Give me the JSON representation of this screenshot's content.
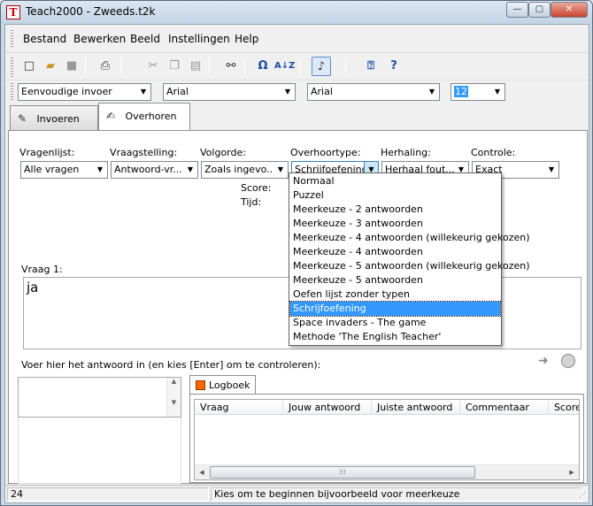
{
  "window": {
    "title": "Teach2000  -  Zweeds.t2k",
    "app_icon": "T"
  },
  "window_controls": {
    "minimize": "—",
    "maximize": "▢",
    "close": "✕"
  },
  "menu": [
    {
      "label": "Bestand"
    },
    {
      "label": "Bewerken"
    },
    {
      "label": "Beeld"
    },
    {
      "label": "Instellingen"
    },
    {
      "label": "Help"
    }
  ],
  "toolbar": {
    "omega": "Ω",
    "sort": "A↓Z"
  },
  "formatbar": {
    "input_mode": "Eenvoudige invoer",
    "font1": "Arial",
    "font2": "Arial",
    "size": "12"
  },
  "tabs": [
    {
      "label": "Invoeren",
      "active": false
    },
    {
      "label": "Overhoren",
      "active": true
    }
  ],
  "fields": {
    "vragenlijst": {
      "label": "Vragenlijst:",
      "value": "Alle vragen"
    },
    "vraagstelling": {
      "label": "Vraagstelling:",
      "value": "Antwoord-vr..."
    },
    "volgorde": {
      "label": "Volgorde:",
      "value": "Zoals ingevo..."
    },
    "overhoortype": {
      "label": "Overhoortype:",
      "value": "Schrijfoefening"
    },
    "herhaling": {
      "label": "Herhaling:",
      "value": "Herhaal fout..."
    },
    "controle": {
      "label": "Controle:",
      "value": "Exact"
    }
  },
  "score_label": "Score:",
  "tijd_label": "Tijd:",
  "dropdown_options": [
    "Normaal",
    "Puzzel",
    "Meerkeuze - 2 antwoorden",
    "Meerkeuze - 3 antwoorden",
    "Meerkeuze - 4 antwoorden (willekeurig gekozen)",
    "Meerkeuze - 4 antwoorden",
    "Meerkeuze - 5 antwoorden (willekeurig gekozen)",
    "Meerkeuze - 5 antwoorden",
    "Oefen lijst zonder typen",
    "Schrijfoefening",
    "Space invaders - The game",
    "Methode 'The English Teacher'"
  ],
  "dropdown_selected_index": 9,
  "question": {
    "label": "Vraag 1:",
    "text": "ja"
  },
  "answer_prompt": "Voer hier het antwoord in (en kies [Enter] om te controleren):",
  "log": {
    "tab": "Logboek",
    "columns": [
      "Vraag",
      "Jouw antwoord",
      "Juiste antwoord",
      "Commentaar",
      "Score"
    ]
  },
  "status": {
    "count": "24",
    "message": "Kies om te beginnen bijvoorbeeld voor meerkeuze"
  },
  "colors": {
    "selection": "#3399ff",
    "log_icon": "#ff6600",
    "close_button": "#c8452f"
  }
}
